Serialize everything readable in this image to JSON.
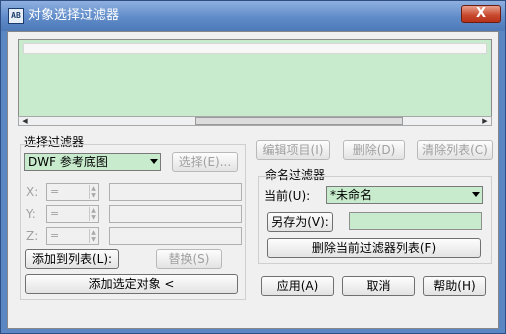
{
  "window": {
    "title": "对象选择过滤器",
    "close_label": "X"
  },
  "app_icon_text": "AB",
  "scroll": {
    "left_arrow": "◀",
    "right_arrow": "▶"
  },
  "select_filter": {
    "heading": "选择过滤器",
    "type_value": "DWF 参考底图",
    "select_button": "选择(E)...",
    "x_label": "X:",
    "y_label": "Y:",
    "z_label": "Z:",
    "operator_value": "=",
    "add_to_list_button": "添加到列表(L):",
    "replace_button": "替换(S)",
    "add_selected_button": "添加选定对象 <"
  },
  "edit_buttons": {
    "edit_item": "编辑项目(I)",
    "delete": "删除(D)",
    "clear_list": "清除列表(C)"
  },
  "named_filters": {
    "heading": "命名过滤器",
    "current_label": "当前(U):",
    "current_value": "*未命名",
    "save_as_button": "另存为(V):",
    "delete_list_button": "删除当前过滤器列表(F)"
  },
  "footer": {
    "apply": "应用(A)",
    "cancel": "取消",
    "help": "帮助(H)"
  },
  "colors": {
    "title_bar": "#5f8bc9",
    "list_bg": "#c8ebcd",
    "close_button": "#c7462a"
  }
}
